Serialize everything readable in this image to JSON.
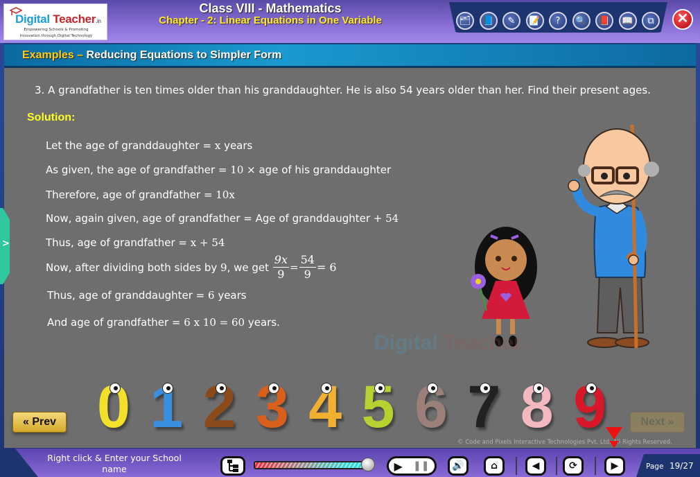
{
  "header": {
    "logo": {
      "brand_part1": "Digital",
      "brand_part2": " Teacher",
      "brand_suffix": ".in",
      "tagline_line1": "Empowering Schools & Promoting",
      "tagline_line2": "Innovation through Digital Technology"
    },
    "title": "Class VIII - Mathematics",
    "subtitle": "Chapter - 2: Linear Equations in One Variable",
    "tools": [
      {
        "name": "folder-clock-icon",
        "glyph": "🗂"
      },
      {
        "name": "book-icon",
        "glyph": "📘"
      },
      {
        "name": "drawing-pad-icon",
        "glyph": "✎"
      },
      {
        "name": "notepad-icon",
        "glyph": "📝"
      },
      {
        "name": "help-icon",
        "glyph": "?"
      },
      {
        "name": "zoom-icon",
        "glyph": "🔍"
      },
      {
        "name": "glossary-book-icon",
        "glyph": "📕"
      },
      {
        "name": "open-book-icon",
        "glyph": "📖"
      },
      {
        "name": "window-resize-icon",
        "glyph": "⧉"
      }
    ],
    "close_glyph": "✕"
  },
  "banner": {
    "label": "Examples",
    "separator": " – ",
    "title": "Reducing Equations to Simpler Form"
  },
  "content": {
    "question": "3. A grandfather is ten times older than his granddaughter. He is also 54 years older than her. Find their present ages.",
    "solution_label": "Solution:",
    "lines": [
      {
        "pre": "Let the age of granddaughter = ",
        "math": "x",
        "post": " years"
      },
      {
        "pre": "As given, the age of grandfather = ",
        "math": "10",
        "post": " × age of his granddaughter"
      },
      {
        "pre": "Therefore, age of grandfather = ",
        "math": "10x",
        "post": ""
      },
      {
        "pre": "Now, again given, age of grandfather = Age of granddaughter + ",
        "math": "54",
        "post": ""
      },
      {
        "pre": "Thus, age of grandfather = ",
        "math": "x + 54",
        "post": ""
      },
      {
        "pre": "Now, after dividing both sides by ",
        "math": "9",
        "post": ", we get"
      },
      {
        "pre": "Thus, age of granddaughter = ",
        "math": "6",
        "post": " years"
      },
      {
        "pre": "And age of grandfather = ",
        "math": "6 x 10 = 60",
        "post": " years."
      }
    ],
    "fraction": {
      "f1_num": "9x",
      "f1_den": "9",
      "eq": "=",
      "f2_num": "54",
      "f2_den": "9",
      "result": "= 6"
    },
    "side_tab_glyph": ">"
  },
  "watermark": {
    "part1": "Digital",
    "part2": " Teacher",
    "suffix": ".in"
  },
  "numbers_strip": {
    "digits": [
      {
        "d": "0",
        "color": "#f2e02a"
      },
      {
        "d": "1",
        "color": "#3a8fe0"
      },
      {
        "d": "2",
        "color": "#8a4a1a"
      },
      {
        "d": "3",
        "color": "#d8601a"
      },
      {
        "d": "4",
        "color": "#f0b030"
      },
      {
        "d": "5",
        "color": "#b8d030"
      },
      {
        "d": "6",
        "color": "#9a8078"
      },
      {
        "d": "7",
        "color": "#222222"
      },
      {
        "d": "8",
        "color": "#f4b8c0"
      },
      {
        "d": "9",
        "color": "#d81828"
      }
    ]
  },
  "nav": {
    "prev_label": "« Prev",
    "next_label": "Next »"
  },
  "copyright": "© Code and Pixels Interactive Technologies  Pvt. Ltd. All Rights Reserved.",
  "footer": {
    "school_text": "Right click & Enter your School name",
    "progress_percent": 98,
    "page_label": "Page",
    "page_value": "19/27"
  },
  "colors": {
    "header_purple": "#8a6fd6",
    "banner_blue": "#1a9ad0",
    "content_gray": "#6e6e6e",
    "title_yellow": "#ffe628",
    "solution_yellow": "#ffff22"
  }
}
